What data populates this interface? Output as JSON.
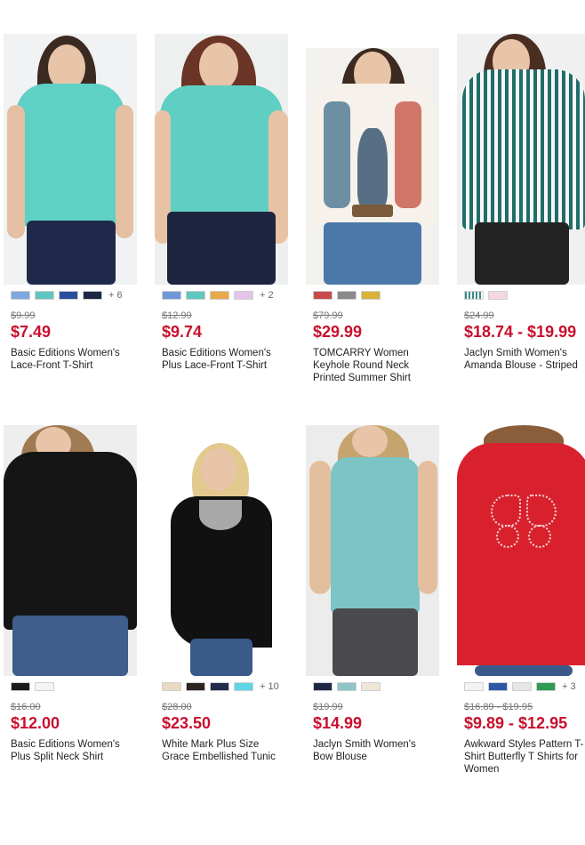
{
  "products": [
    {
      "name": "Basic Editions Women's Lace-Front T-Shirt",
      "original_price": "$9.99",
      "price": "$7.49",
      "swatches": [
        "#7fa8e0",
        "#62c4c0",
        "#2a4e9c",
        "#1c2744"
      ],
      "more_colors": "+ 6"
    },
    {
      "name": "Basic Editions Women's Plus Lace-Front T-Shirt",
      "original_price": "$12.99",
      "price": "$9.74",
      "swatches": [
        "#6f98da",
        "#5ec7bf",
        "#e9a84a",
        "#e6c4e8"
      ],
      "more_colors": "+ 2"
    },
    {
      "name": "TOMCARRY Women Keyhole Round Neck Printed Summer Shirt",
      "original_price": "$79.99",
      "price": "$29.99",
      "swatches": [
        "#c94a4a",
        "#8a8a8a",
        "#d9b23a"
      ],
      "more_colors": ""
    },
    {
      "name": "Jaclyn Smith Women's Amanda Blouse - Striped",
      "original_price": "$24.99",
      "price": "$18.74 - $19.99",
      "swatches": [
        "#3f8c8c",
        "#f3d9df"
      ],
      "more_colors": ""
    },
    {
      "name": "Basic Editions Women's Plus Split Neck Shirt",
      "original_price": "$16.00",
      "price": "$12.00",
      "swatches": [
        "#1b1b1b",
        "#f4f4f4"
      ],
      "more_colors": ""
    },
    {
      "name": "White Mark Plus Size Grace Embellished Tunic",
      "original_price": "$28.00",
      "price": "$23.50",
      "swatches": [
        "#eadac4",
        "#2b2420",
        "#1f2a4d",
        "#5fd6e6"
      ],
      "more_colors": "+ 10"
    },
    {
      "name": "Jaclyn Smith Women's Bow Blouse",
      "original_price": "$19.99",
      "price": "$14.99",
      "swatches": [
        "#1e2742",
        "#8fc4c8",
        "#efe6d6"
      ],
      "more_colors": ""
    },
    {
      "name": "Awkward Styles Pattern T-Shirt Butterfly T Shirts for Women",
      "original_price": "$16.89 - $19.95",
      "price": "$9.89 - $12.95",
      "swatches": [
        "#f3f3f3",
        "#2f57a8",
        "#e6e6e6",
        "#2e9a52"
      ],
      "more_colors": "+ 3"
    }
  ],
  "colors": {
    "price_red": "#c8102e",
    "strike_gray": "#777777"
  }
}
